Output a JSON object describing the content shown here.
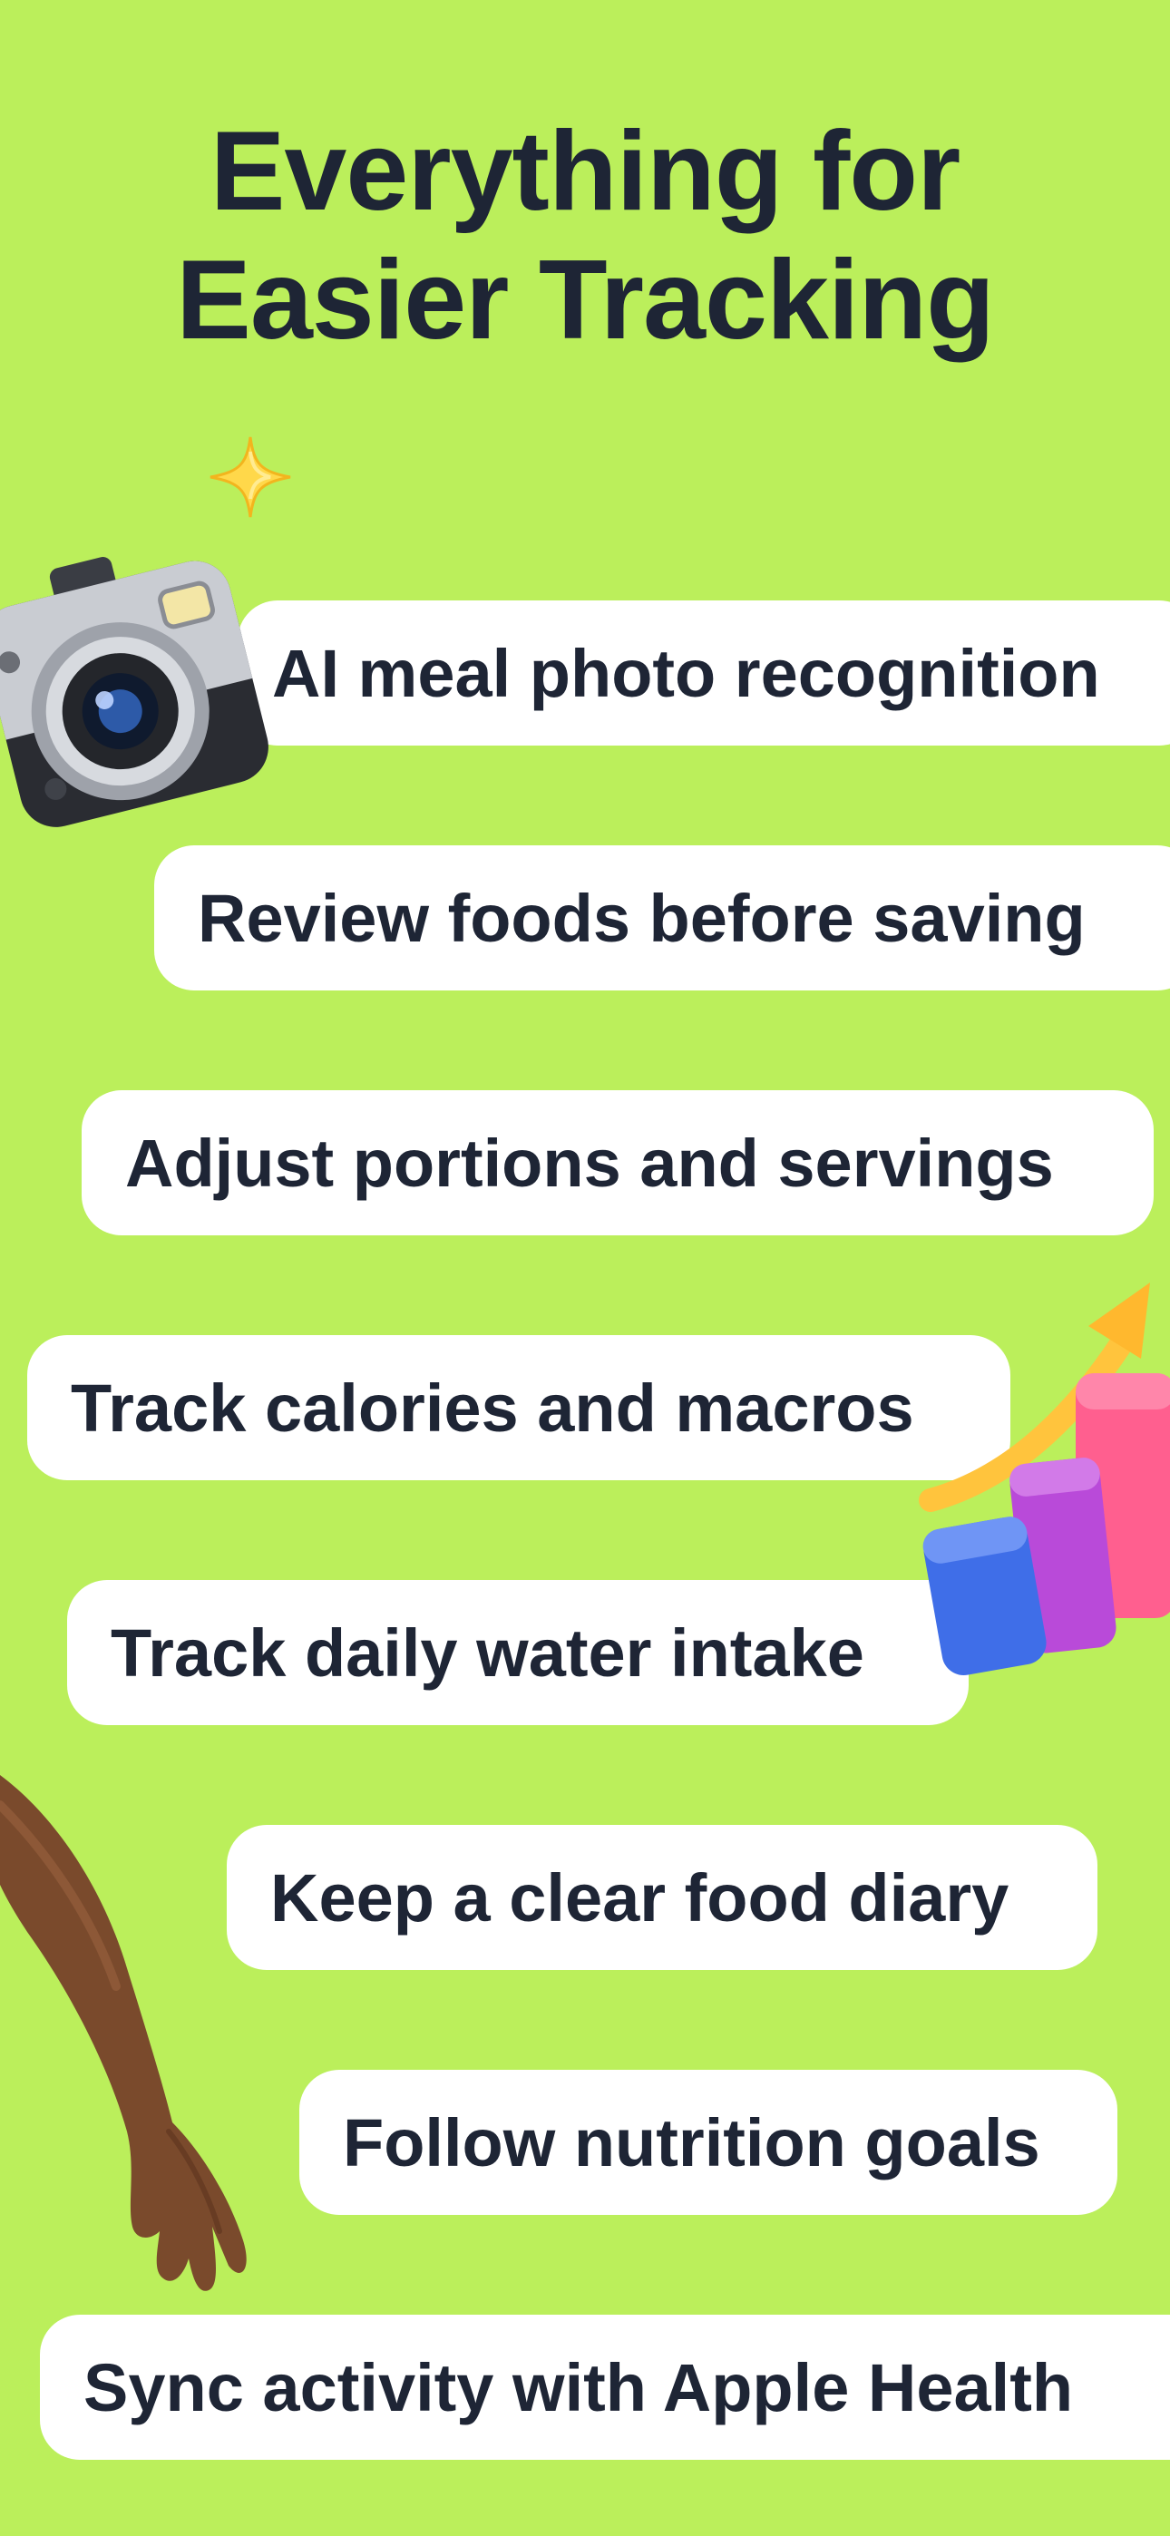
{
  "headline": {
    "line1": "Everything for",
    "line2": "Easier Tracking"
  },
  "features": [
    {
      "label": "AI meal photo recognition"
    },
    {
      "label": "Review foods before saving"
    },
    {
      "label": "Adjust portions and servings"
    },
    {
      "label": "Track calories and macros"
    },
    {
      "label": "Track daily water intake"
    },
    {
      "label": "Keep a clear food diary"
    },
    {
      "label": "Follow nutrition goals"
    },
    {
      "label": "Sync activity with Apple Health"
    }
  ],
  "icons": {
    "sparkle": "sparkle-icon",
    "camera": "camera-icon",
    "growth_chart": "growth-chart-icon",
    "arm": "arm-illustration"
  },
  "colors": {
    "background": "#bbef5b",
    "text": "#1e2535",
    "pill": "#ffffff"
  }
}
